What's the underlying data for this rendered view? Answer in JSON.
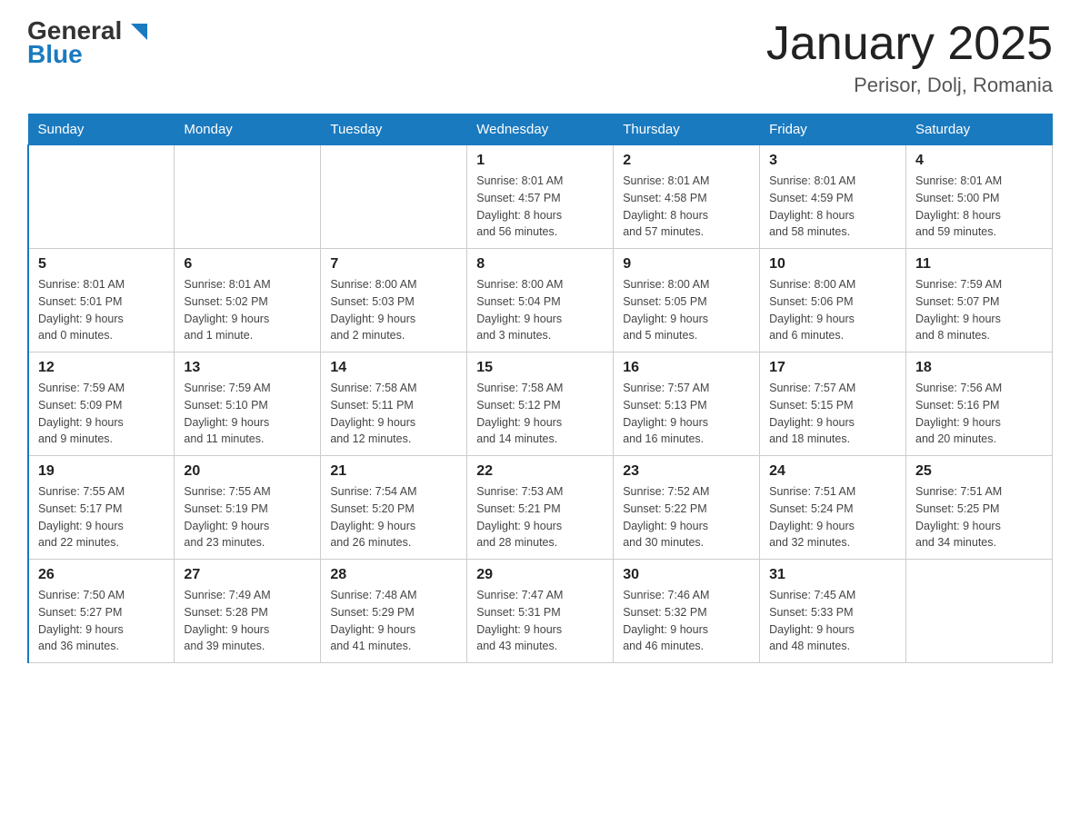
{
  "header": {
    "logo_general": "General",
    "logo_blue": "Blue",
    "title": "January 2025",
    "subtitle": "Perisor, Dolj, Romania"
  },
  "days_of_week": [
    "Sunday",
    "Monday",
    "Tuesday",
    "Wednesday",
    "Thursday",
    "Friday",
    "Saturday"
  ],
  "weeks": [
    {
      "days": [
        {
          "number": "",
          "info": ""
        },
        {
          "number": "",
          "info": ""
        },
        {
          "number": "",
          "info": ""
        },
        {
          "number": "1",
          "info": "Sunrise: 8:01 AM\nSunset: 4:57 PM\nDaylight: 8 hours\nand 56 minutes."
        },
        {
          "number": "2",
          "info": "Sunrise: 8:01 AM\nSunset: 4:58 PM\nDaylight: 8 hours\nand 57 minutes."
        },
        {
          "number": "3",
          "info": "Sunrise: 8:01 AM\nSunset: 4:59 PM\nDaylight: 8 hours\nand 58 minutes."
        },
        {
          "number": "4",
          "info": "Sunrise: 8:01 AM\nSunset: 5:00 PM\nDaylight: 8 hours\nand 59 minutes."
        }
      ]
    },
    {
      "days": [
        {
          "number": "5",
          "info": "Sunrise: 8:01 AM\nSunset: 5:01 PM\nDaylight: 9 hours\nand 0 minutes."
        },
        {
          "number": "6",
          "info": "Sunrise: 8:01 AM\nSunset: 5:02 PM\nDaylight: 9 hours\nand 1 minute."
        },
        {
          "number": "7",
          "info": "Sunrise: 8:00 AM\nSunset: 5:03 PM\nDaylight: 9 hours\nand 2 minutes."
        },
        {
          "number": "8",
          "info": "Sunrise: 8:00 AM\nSunset: 5:04 PM\nDaylight: 9 hours\nand 3 minutes."
        },
        {
          "number": "9",
          "info": "Sunrise: 8:00 AM\nSunset: 5:05 PM\nDaylight: 9 hours\nand 5 minutes."
        },
        {
          "number": "10",
          "info": "Sunrise: 8:00 AM\nSunset: 5:06 PM\nDaylight: 9 hours\nand 6 minutes."
        },
        {
          "number": "11",
          "info": "Sunrise: 7:59 AM\nSunset: 5:07 PM\nDaylight: 9 hours\nand 8 minutes."
        }
      ]
    },
    {
      "days": [
        {
          "number": "12",
          "info": "Sunrise: 7:59 AM\nSunset: 5:09 PM\nDaylight: 9 hours\nand 9 minutes."
        },
        {
          "number": "13",
          "info": "Sunrise: 7:59 AM\nSunset: 5:10 PM\nDaylight: 9 hours\nand 11 minutes."
        },
        {
          "number": "14",
          "info": "Sunrise: 7:58 AM\nSunset: 5:11 PM\nDaylight: 9 hours\nand 12 minutes."
        },
        {
          "number": "15",
          "info": "Sunrise: 7:58 AM\nSunset: 5:12 PM\nDaylight: 9 hours\nand 14 minutes."
        },
        {
          "number": "16",
          "info": "Sunrise: 7:57 AM\nSunset: 5:13 PM\nDaylight: 9 hours\nand 16 minutes."
        },
        {
          "number": "17",
          "info": "Sunrise: 7:57 AM\nSunset: 5:15 PM\nDaylight: 9 hours\nand 18 minutes."
        },
        {
          "number": "18",
          "info": "Sunrise: 7:56 AM\nSunset: 5:16 PM\nDaylight: 9 hours\nand 20 minutes."
        }
      ]
    },
    {
      "days": [
        {
          "number": "19",
          "info": "Sunrise: 7:55 AM\nSunset: 5:17 PM\nDaylight: 9 hours\nand 22 minutes."
        },
        {
          "number": "20",
          "info": "Sunrise: 7:55 AM\nSunset: 5:19 PM\nDaylight: 9 hours\nand 23 minutes."
        },
        {
          "number": "21",
          "info": "Sunrise: 7:54 AM\nSunset: 5:20 PM\nDaylight: 9 hours\nand 26 minutes."
        },
        {
          "number": "22",
          "info": "Sunrise: 7:53 AM\nSunset: 5:21 PM\nDaylight: 9 hours\nand 28 minutes."
        },
        {
          "number": "23",
          "info": "Sunrise: 7:52 AM\nSunset: 5:22 PM\nDaylight: 9 hours\nand 30 minutes."
        },
        {
          "number": "24",
          "info": "Sunrise: 7:51 AM\nSunset: 5:24 PM\nDaylight: 9 hours\nand 32 minutes."
        },
        {
          "number": "25",
          "info": "Sunrise: 7:51 AM\nSunset: 5:25 PM\nDaylight: 9 hours\nand 34 minutes."
        }
      ]
    },
    {
      "days": [
        {
          "number": "26",
          "info": "Sunrise: 7:50 AM\nSunset: 5:27 PM\nDaylight: 9 hours\nand 36 minutes."
        },
        {
          "number": "27",
          "info": "Sunrise: 7:49 AM\nSunset: 5:28 PM\nDaylight: 9 hours\nand 39 minutes."
        },
        {
          "number": "28",
          "info": "Sunrise: 7:48 AM\nSunset: 5:29 PM\nDaylight: 9 hours\nand 41 minutes."
        },
        {
          "number": "29",
          "info": "Sunrise: 7:47 AM\nSunset: 5:31 PM\nDaylight: 9 hours\nand 43 minutes."
        },
        {
          "number": "30",
          "info": "Sunrise: 7:46 AM\nSunset: 5:32 PM\nDaylight: 9 hours\nand 46 minutes."
        },
        {
          "number": "31",
          "info": "Sunrise: 7:45 AM\nSunset: 5:33 PM\nDaylight: 9 hours\nand 48 minutes."
        },
        {
          "number": "",
          "info": ""
        }
      ]
    }
  ]
}
